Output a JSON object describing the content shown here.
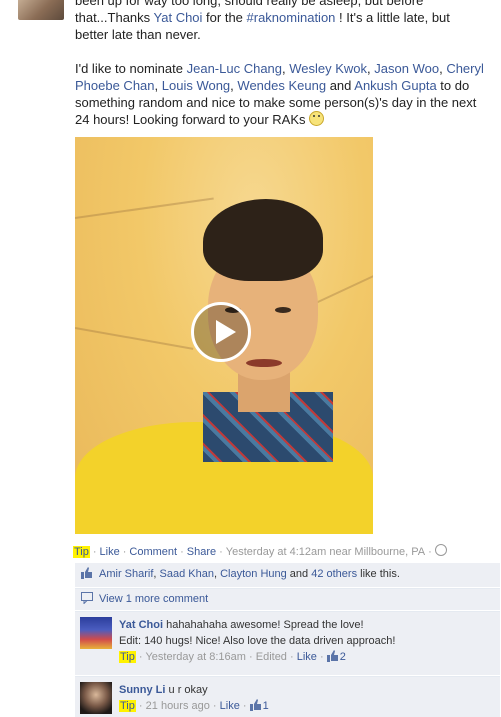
{
  "post": {
    "line0": "been up for way too long, should really be asleep, but before",
    "line1_a": "that...Thanks ",
    "thanked": "Yat Choi",
    "line1_b": " for the ",
    "hashtag": "#raknomination",
    "line1_c": " ! It's a little late, but better late than never.",
    "nominate_intro": "I'd like to nominate ",
    "nominees": [
      "Jean-Luc Chang",
      "Wesley Kwok",
      "Jason Woo",
      "Cheryl Phoebe Chan",
      "Louis Wong",
      "Wendes Keung"
    ],
    "and_word": " and ",
    "last_nominee": "Ankush Gupta",
    "nominate_outro": " to do something random and nice to make some person(s)'s day in the next 24 hours! Looking forward to your RAKs "
  },
  "actions": {
    "tip": "Tip",
    "like": "Like",
    "comment": "Comment",
    "share": "Share",
    "timestamp": "Yesterday at 4:12am near Millbourne, PA"
  },
  "likes": {
    "names": [
      "Amir Sharif",
      "Saad Khan",
      "Clayton Hung"
    ],
    "and_word": " and ",
    "others": "42 others",
    "suffix": " like this."
  },
  "view_more": "View 1 more comment",
  "comments": [
    {
      "name": "Yat Choi",
      "text": "hahahahaha awesome! Spread the love!",
      "text2": "Edit: 140 hugs! Nice! Also love the data driven approach!",
      "tip": "Tip",
      "time": "Yesterday at 8:16am",
      "edited": "Edited",
      "like": "Like",
      "like_count": "2"
    },
    {
      "name": "Sunny Li",
      "text": "u r okay",
      "tip": "Tip",
      "time": "21 hours ago",
      "like": "Like",
      "like_count": "1"
    }
  ],
  "colors": {
    "link": "#3b5998",
    "highlight": "#fff200",
    "ufi_bg": "#edeff4"
  },
  "icons": [
    "play-icon",
    "globe-icon",
    "thumbs-up-icon",
    "smiley-icon",
    "comment-bubble-icon"
  ]
}
